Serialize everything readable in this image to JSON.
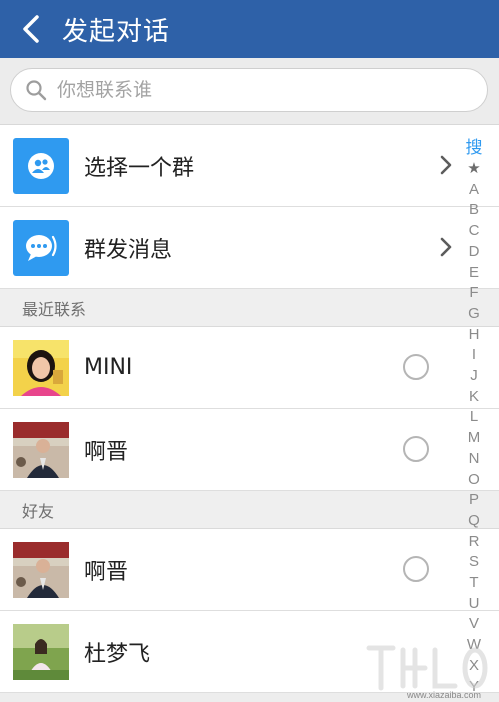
{
  "header": {
    "title": "发起对话"
  },
  "search": {
    "placeholder": "你想联系谁"
  },
  "actions": [
    {
      "label": "选择一个群",
      "icon": "group-icon"
    },
    {
      "label": "群发消息",
      "icon": "broadcast-message-icon"
    }
  ],
  "sections": {
    "recent": "最近联系",
    "friends": "好友"
  },
  "recent_contacts": [
    {
      "name": "MINI"
    },
    {
      "name": "啊晋"
    }
  ],
  "friends": [
    {
      "name": "啊晋"
    },
    {
      "name": "杜梦飞"
    }
  ],
  "index": [
    "搜",
    "★",
    "A",
    "B",
    "C",
    "D",
    "E",
    "F",
    "G",
    "H",
    "I",
    "J",
    "K",
    "L",
    "M",
    "N",
    "O",
    "P",
    "Q",
    "R",
    "S",
    "T",
    "U",
    "V",
    "W",
    "X",
    "Y"
  ],
  "watermark": {
    "url": "www.xiazaiba.com"
  },
  "colors": {
    "header_bg": "#2e61a8",
    "accent": "#2f9af0"
  }
}
